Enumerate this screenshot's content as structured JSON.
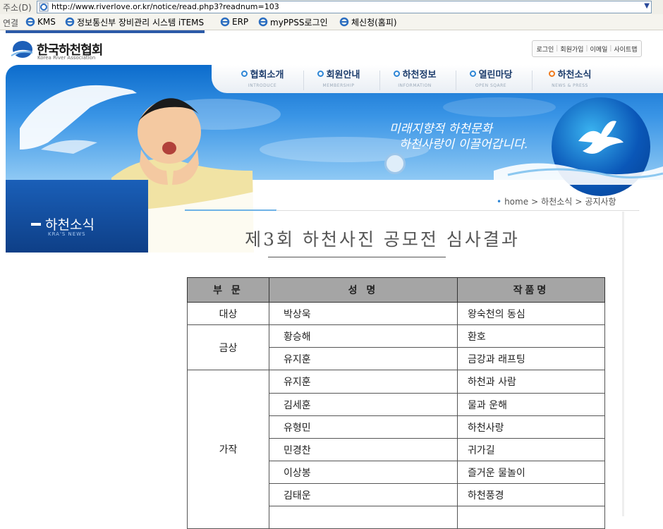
{
  "browser": {
    "address_label": "주소(D)",
    "url": "http://www.riverlove.or.kr/notice/read.php3?readnum=103",
    "links_label": "연결",
    "links": [
      "KMS",
      "정보통신부 장비관리 시스템 iTEMS",
      "ERP",
      "myPPSS로그인",
      "체신청(홈피)"
    ]
  },
  "header": {
    "logo_text": "한국하천협회",
    "logo_sub": "Korea River Association",
    "top_links": [
      "로그인",
      "회원가입",
      "이메일",
      "사이트맵"
    ]
  },
  "nav": [
    {
      "label": "협회소개",
      "sub": "INTRODUCE"
    },
    {
      "label": "회원안내",
      "sub": "MEMBERSHIP"
    },
    {
      "label": "하천정보",
      "sub": "INFORMATION"
    },
    {
      "label": "열린마당",
      "sub": "OPEN SQARE"
    },
    {
      "label": "하천소식",
      "sub": "NEWS & PRESS"
    }
  ],
  "banner": {
    "slogan_line1": "미래지향적 하천문화",
    "slogan_line2": "하천사랑이 이끌어갑니다."
  },
  "side": {
    "title": "하천소식",
    "subtitle": "KRA'S NEWS"
  },
  "breadcrumb": [
    "home",
    "하천소식",
    "공지사항"
  ],
  "title": "제3회 하천사진 공모전 심사결과",
  "table": {
    "headers": [
      "부 문",
      "성 명",
      "작품명"
    ],
    "rows": [
      {
        "category": "대상",
        "name": "박상욱",
        "work": "왕숙천의 동심"
      },
      {
        "category": "금상",
        "name": "황승해",
        "work": "환호"
      },
      {
        "category": "",
        "name": "유지훈",
        "work": "금강과 래프팅"
      },
      {
        "category": "가작",
        "name": "유지훈",
        "work": "하천과 사람"
      },
      {
        "category": "",
        "name": "김세훈",
        "work": "물과 운해"
      },
      {
        "category": "",
        "name": "유형민",
        "work": "하천사랑"
      },
      {
        "category": "",
        "name": "민경찬",
        "work": "귀가길"
      },
      {
        "category": "",
        "name": "이상봉",
        "work": "즐거운 물놀이"
      },
      {
        "category": "",
        "name": "김태운",
        "work": "하천풍경"
      }
    ]
  }
}
